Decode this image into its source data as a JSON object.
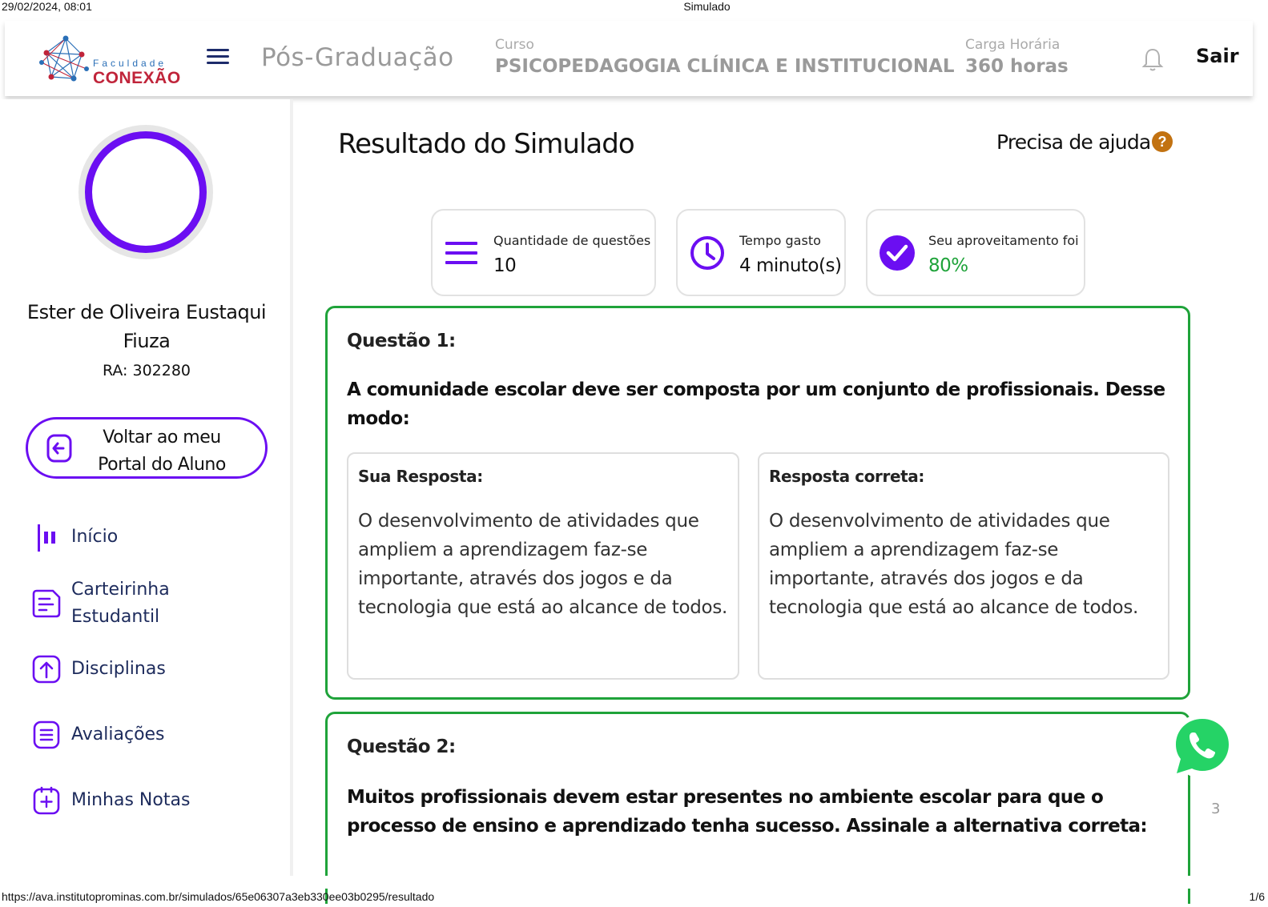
{
  "print_header": {
    "date": "29/02/2024, 08:01",
    "title": "Simulado"
  },
  "print_footer": {
    "url": "https://ava.institutoprominas.com.br/simulados/65e06307a3eb330ee03b0295/resultado",
    "page": "1/6"
  },
  "header": {
    "logo_small": "Faculdade",
    "logo_big": "CONEXÃO",
    "program": "Pós-Graduação",
    "course_label": "Curso",
    "course_value": "PSICOPEDAGOGIA CLÍNICA E INSTITUCIONAL",
    "hours_label": "Carga Horária",
    "hours_value": "360 horas",
    "logout": "Sair"
  },
  "sidebar": {
    "user_name": "Ester de Oliveira Eustaqui Fiuza",
    "ra": "RA: 302280",
    "portal_button": "Voltar ao meu Portal do Aluno",
    "items": [
      {
        "label": "Início",
        "icon": "bar-chart-icon"
      },
      {
        "label": "Carteirinha Estudantil",
        "icon": "id-card-icon"
      },
      {
        "label": "Disciplinas",
        "icon": "upload-arrow-icon"
      },
      {
        "label": "Avaliações",
        "icon": "list-box-icon"
      },
      {
        "label": "Minhas Notas",
        "icon": "plus-box-icon"
      }
    ]
  },
  "main": {
    "title": "Resultado do Simulado",
    "help": "Precisa de ajuda",
    "stats": [
      {
        "label": "Quantidade de questões",
        "value": "10",
        "icon": "list-icon"
      },
      {
        "label": "Tempo gasto",
        "value": "4 minuto(s)",
        "icon": "clock-icon"
      },
      {
        "label": "Seu aproveitamento foi",
        "value": "80%",
        "icon": "check-circle-icon"
      }
    ],
    "questions": [
      {
        "title": "Questão 1:",
        "statement": "A comunidade escolar deve ser composta por um conjunto de profissionais. Desse modo:",
        "your_answer_label": "Sua Resposta:",
        "your_answer": "O desenvolvimento de atividades que ampliem a aprendizagem faz-se importante, através dos jogos e da tecnologia que está ao alcance de todos.",
        "correct_answer_label": "Resposta correta:",
        "correct_answer": "O desenvolvimento de atividades que ampliem a aprendizagem faz-se importante, através dos jogos e da tecnologia que está ao alcance de todos."
      },
      {
        "title": "Questão 2:",
        "statement": "Muitos profissionais devem estar presentes no ambiente escolar para que o processo de ensino e aprendizado tenha sucesso. Assinale a alternativa correta:"
      }
    ],
    "floating_number": "3"
  },
  "colors": {
    "accent": "#6b0ef2",
    "success": "#1fa33a",
    "help_icon": "#c27211",
    "nav_text": "#1d2b5c"
  }
}
